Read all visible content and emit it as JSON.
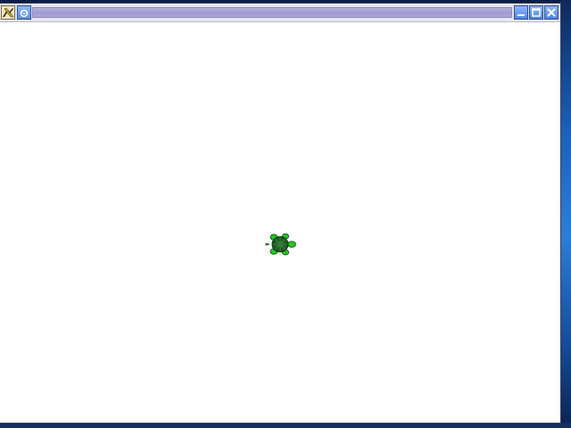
{
  "window": {
    "title": "",
    "buttons": {
      "menu": "window-menu-icon",
      "sticky": "sticky-icon",
      "minimize": "minimize-icon",
      "maximize": "maximize-icon",
      "close": "close-icon"
    }
  },
  "canvas": {
    "background": "#ffffff",
    "sprite": {
      "name": "turtle-icon",
      "color": "#22c522",
      "shell_color": "#1f5a24",
      "heading": "east"
    }
  },
  "colors": {
    "title_accent": "#9d9ad0",
    "button_blue": "#5b8ee0",
    "desktop_blue": "#2c5aa4"
  }
}
